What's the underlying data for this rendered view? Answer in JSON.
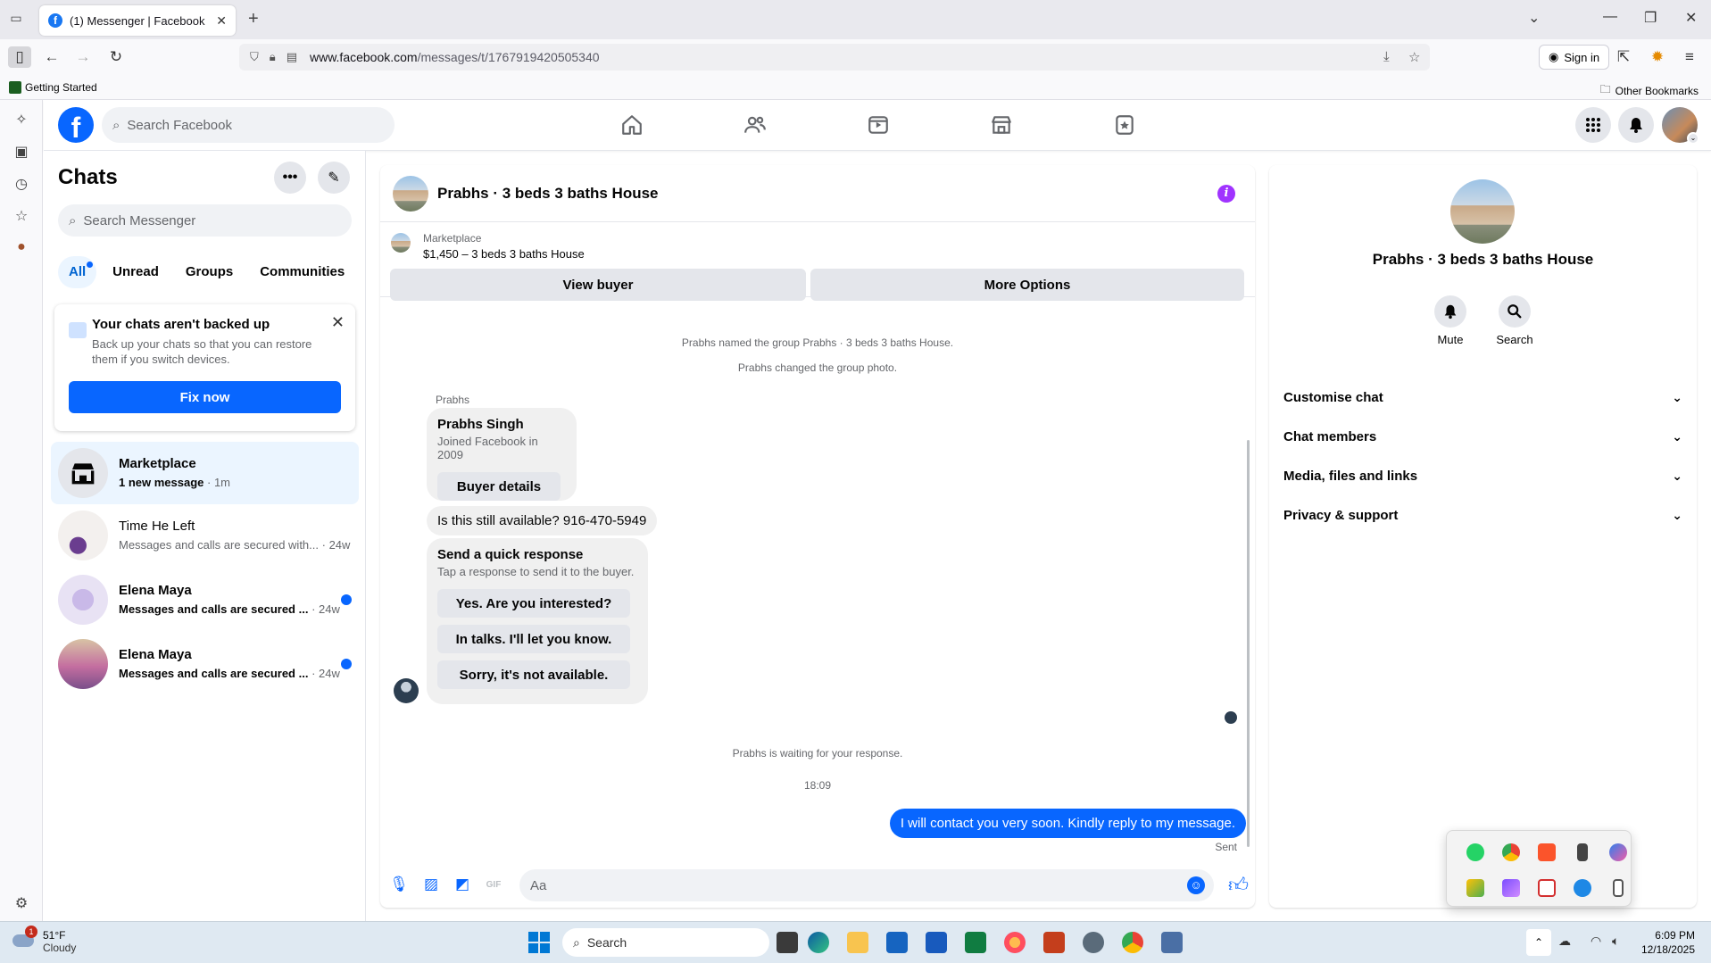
{
  "browser": {
    "tab_title": "(1) Messenger | Facebook",
    "url_host": "www.facebook.com",
    "url_path": "/messages/t/1767919420505340",
    "sign_in": "Sign in",
    "bookmark_getting_started": "Getting Started",
    "bookmark_other": "Other Bookmarks"
  },
  "fb_header": {
    "search_placeholder": "Search Facebook"
  },
  "chats": {
    "title": "Chats",
    "search_placeholder": "Search Messenger",
    "filters": [
      "All",
      "Unread",
      "Groups",
      "Communities"
    ],
    "backup": {
      "title": "Your chats aren't backed up",
      "body": "Back up your chats so that you can restore them if you switch devices.",
      "button": "Fix now"
    },
    "items": [
      {
        "name": "Marketplace",
        "preview": "1 new message",
        "time": "· 1m"
      },
      {
        "name": "Time He Left",
        "preview": "Messages and calls are secured with...",
        "time": "· 24w"
      },
      {
        "name": "Elena Maya",
        "preview": "Messages and calls are secured ...",
        "time": "· 24w"
      },
      {
        "name": "Elena Maya",
        "preview": "Messages and calls are secured ...",
        "time": "· 24w"
      }
    ]
  },
  "conversation": {
    "title": "Prabhs · 3 beds 3 baths House",
    "marketplace_label": "Marketplace",
    "listing": "$1,450 – 3 beds 3 baths House",
    "view_buyer": "View buyer",
    "more_options": "More Options",
    "system_1": "Prabhs named the group Prabhs · 3 beds 3 baths House.",
    "system_2": "Prabhs changed the group photo.",
    "sender_label": "Prabhs",
    "profile_name": "Prabhs Singh",
    "profile_sub": "Joined Facebook in 2009",
    "buyer_details": "Buyer details",
    "message_1": "Is this still available? 916-470-5949",
    "quick_title": "Send a quick response",
    "quick_sub": "Tap a response to send it to the buyer.",
    "quick_replies": [
      "Yes. Are you interested?",
      "In talks. I'll let you know.",
      "Sorry, it's not available."
    ],
    "waiting": "Prabhs is waiting for your response.",
    "timestamp": "18:09",
    "sent_message": "I will contact you very soon. Kindly reply to my message.",
    "sent_status": "Sent",
    "composer_placeholder": "Aa"
  },
  "info_panel": {
    "title": "Prabhs · 3 beds 3 baths House",
    "mute": "Mute",
    "search": "Search",
    "sections": [
      "Customise chat",
      "Chat members",
      "Media, files and links",
      "Privacy & support"
    ]
  },
  "taskbar": {
    "weather_temp": "51°F",
    "weather_cond": "Cloudy",
    "weather_badge": "1",
    "search_label": "Search",
    "time": "6:09 PM",
    "date": "12/18/2025"
  },
  "colors": {
    "fb_blue": "#0866ff",
    "info_purple": "#a033ff",
    "selected_bg": "#ebf5ff"
  }
}
